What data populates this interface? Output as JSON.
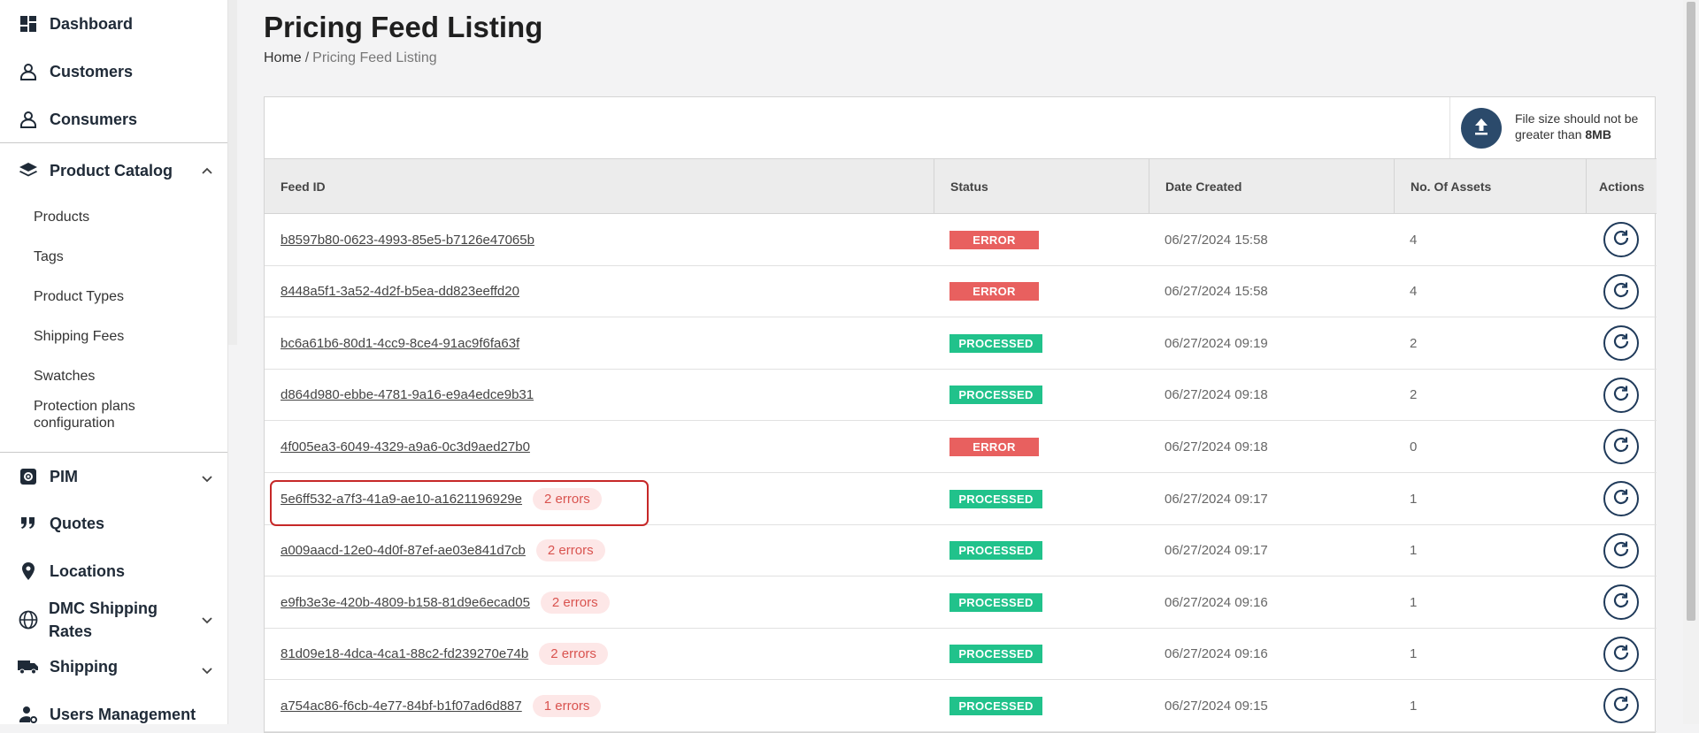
{
  "sidebar": {
    "dashboard": "Dashboard",
    "customers": "Customers",
    "consumers": "Consumers",
    "product_catalog": "Product Catalog",
    "sub": [
      "Products",
      "Tags",
      "Product Types",
      "Shipping Fees",
      "Swatches",
      "Protection plans configuration"
    ],
    "pim": "PIM",
    "quotes": "Quotes",
    "locations": "Locations",
    "dmc": "DMC Shipping Rates",
    "shipping": "Shipping",
    "users": "Users Management"
  },
  "page": {
    "title": "Pricing Feed Listing",
    "breadcrumb_home": "Home",
    "breadcrumb_sep": "/",
    "breadcrumb_current": "Pricing Feed Listing"
  },
  "upload": {
    "note_prefix": "File size should not be greater than ",
    "note_size": "8MB"
  },
  "table": {
    "headers": [
      "Feed ID",
      "Status",
      "Date Created",
      "No. Of Assets",
      "Actions"
    ],
    "rows": [
      {
        "id": "b8597b80-0623-4993-85e5-b7126e47065b",
        "errors": "",
        "status": "ERROR",
        "date": "06/27/2024 15:58",
        "assets": "4"
      },
      {
        "id": "8448a5f1-3a52-4d2f-b5ea-dd823eeffd20",
        "errors": "",
        "status": "ERROR",
        "date": "06/27/2024 15:58",
        "assets": "4"
      },
      {
        "id": "bc6a61b6-80d1-4cc9-8ce4-91ac9f6fa63f",
        "errors": "",
        "status": "PROCESSED",
        "date": "06/27/2024 09:19",
        "assets": "2"
      },
      {
        "id": "d864d980-ebbe-4781-9a16-e9a4edce9b31",
        "errors": "",
        "status": "PROCESSED",
        "date": "06/27/2024 09:18",
        "assets": "2"
      },
      {
        "id": "4f005ea3-6049-4329-a9a6-0c3d9aed27b0",
        "errors": "",
        "status": "ERROR",
        "date": "06/27/2024 09:18",
        "assets": "0"
      },
      {
        "id": "5e6ff532-a7f3-41a9-ae10-a1621196929e",
        "errors": "2 errors",
        "status": "PROCESSED",
        "date": "06/27/2024 09:17",
        "assets": "1"
      },
      {
        "id": "a009aacd-12e0-4d0f-87ef-ae03e841d7cb",
        "errors": "2 errors",
        "status": "PROCESSED",
        "date": "06/27/2024 09:17",
        "assets": "1"
      },
      {
        "id": "e9fb3e3e-420b-4809-b158-81d9e6ecad05",
        "errors": "2 errors",
        "status": "PROCESSED",
        "date": "06/27/2024 09:16",
        "assets": "1"
      },
      {
        "id": "81d09e18-4dca-4ca1-88c2-fd239270e74b",
        "errors": "2 errors",
        "status": "PROCESSED",
        "date": "06/27/2024 09:16",
        "assets": "1"
      },
      {
        "id": "a754ac86-f6cb-4e77-84bf-b1f07ad6d887",
        "errors": "1 errors",
        "status": "PROCESSED",
        "date": "06/27/2024 09:15",
        "assets": "1"
      }
    ]
  },
  "colors": {
    "error": "#e8605f",
    "processed": "#21c28b",
    "accent": "#2b4a6b",
    "highlight": "#c62828"
  }
}
